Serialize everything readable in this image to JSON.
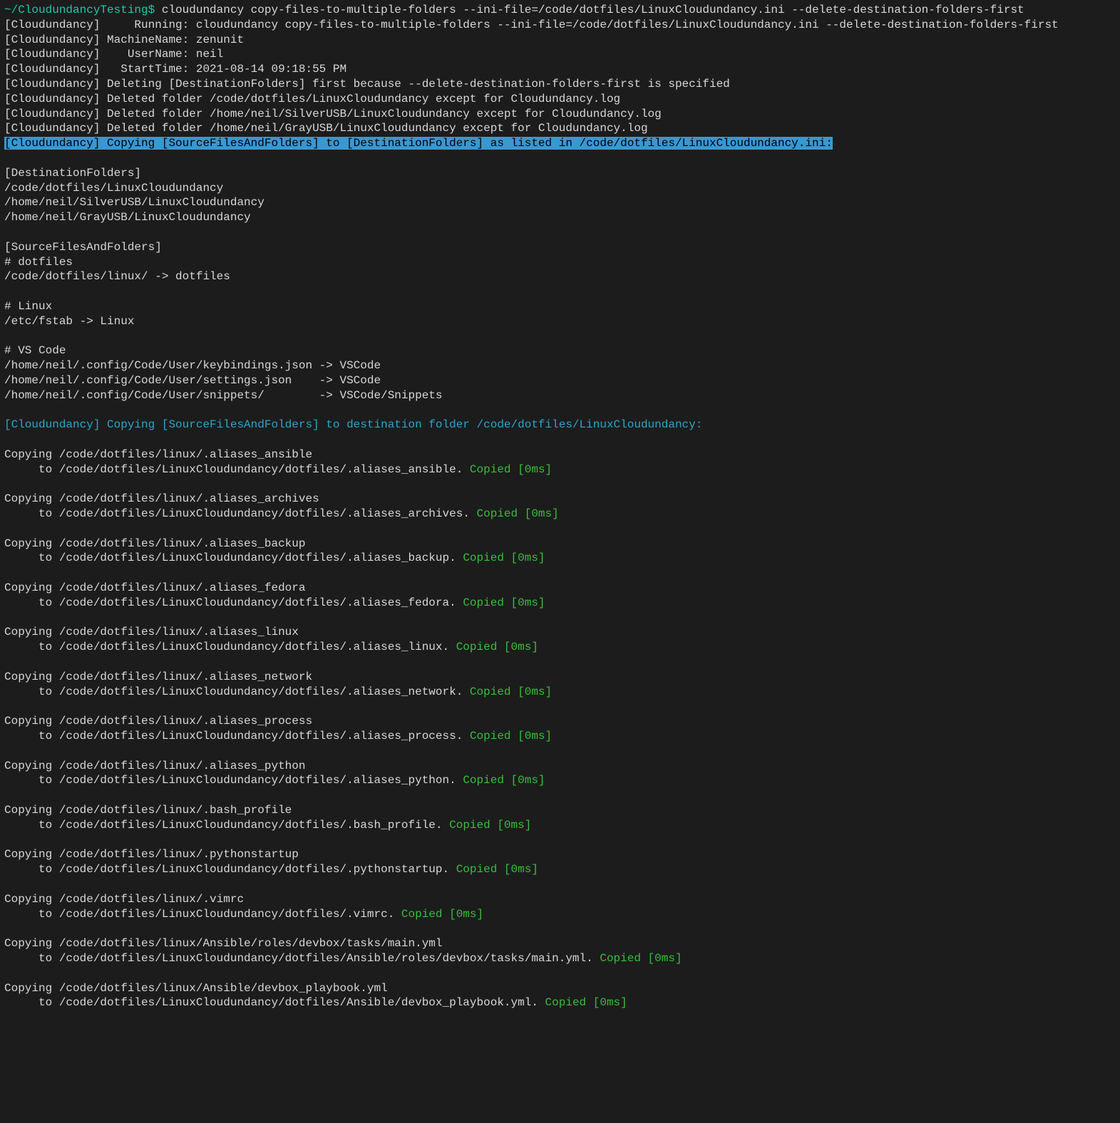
{
  "prompt": {
    "path": "~/CloudundancyTesting",
    "dollar": "$ "
  },
  "cmd": "cloudundancy copy-files-to-multiple-folders --ini-file=/code/dotfiles/LinuxCloudundancy.ini --delete-destination-folders-first",
  "hdr": [
    "[Cloudundancy]     Running: cloudundancy copy-files-to-multiple-folders --ini-file=/code/dotfiles/LinuxCloudundancy.ini --delete-destination-folders-first",
    "[Cloudundancy] MachineName: zenunit",
    "[Cloudundancy]    UserName: neil",
    "[Cloudundancy]   StartTime: 2021-08-14 09:18:55 PM",
    "[Cloudundancy] Deleting [DestinationFolders] first because --delete-destination-folders-first is specified",
    "[Cloudundancy] Deleted folder /code/dotfiles/LinuxCloudundancy except for Cloudundancy.log",
    "[Cloudundancy] Deleted folder /home/neil/SilverUSB/LinuxCloudundancy except for Cloudundancy.log",
    "[Cloudundancy] Deleted folder /home/neil/GrayUSB/LinuxCloudundancy except for Cloudundancy.log"
  ],
  "highlight": "[Cloudundancy] Copying [SourceFilesAndFolders] to [DestinationFolders] as listed in /code/dotfiles/LinuxCloudundancy.ini:",
  "body": [
    "",
    "[DestinationFolders]",
    "/code/dotfiles/LinuxCloudundancy",
    "/home/neil/SilverUSB/LinuxCloudundancy",
    "/home/neil/GrayUSB/LinuxCloudundancy",
    "",
    "[SourceFilesAndFolders]",
    "# dotfiles",
    "/code/dotfiles/linux/ -> dotfiles",
    "",
    "# Linux",
    "/etc/fstab -> Linux",
    "",
    "# VS Code",
    "/home/neil/.config/Code/User/keybindings.json -> VSCode",
    "/home/neil/.config/Code/User/settings.json    -> VSCode",
    "/home/neil/.config/Code/User/snippets/        -> VSCode/Snippets",
    ""
  ],
  "copyingHeader": "[Cloudundancy] Copying [SourceFilesAndFolders] to destination folder /code/dotfiles/LinuxCloudundancy:",
  "copies": [
    {
      "src": "Copying /code/dotfiles/linux/.aliases_ansible",
      "dst": "     to /code/dotfiles/LinuxCloudundancy/dotfiles/.aliases_ansible. ",
      "res": "Copied [0ms]"
    },
    {
      "src": "Copying /code/dotfiles/linux/.aliases_archives",
      "dst": "     to /code/dotfiles/LinuxCloudundancy/dotfiles/.aliases_archives. ",
      "res": "Copied [0ms]"
    },
    {
      "src": "Copying /code/dotfiles/linux/.aliases_backup",
      "dst": "     to /code/dotfiles/LinuxCloudundancy/dotfiles/.aliases_backup. ",
      "res": "Copied [0ms]"
    },
    {
      "src": "Copying /code/dotfiles/linux/.aliases_fedora",
      "dst": "     to /code/dotfiles/LinuxCloudundancy/dotfiles/.aliases_fedora. ",
      "res": "Copied [0ms]"
    },
    {
      "src": "Copying /code/dotfiles/linux/.aliases_linux",
      "dst": "     to /code/dotfiles/LinuxCloudundancy/dotfiles/.aliases_linux. ",
      "res": "Copied [0ms]"
    },
    {
      "src": "Copying /code/dotfiles/linux/.aliases_network",
      "dst": "     to /code/dotfiles/LinuxCloudundancy/dotfiles/.aliases_network. ",
      "res": "Copied [0ms]"
    },
    {
      "src": "Copying /code/dotfiles/linux/.aliases_process",
      "dst": "     to /code/dotfiles/LinuxCloudundancy/dotfiles/.aliases_process. ",
      "res": "Copied [0ms]"
    },
    {
      "src": "Copying /code/dotfiles/linux/.aliases_python",
      "dst": "     to /code/dotfiles/LinuxCloudundancy/dotfiles/.aliases_python. ",
      "res": "Copied [0ms]"
    },
    {
      "src": "Copying /code/dotfiles/linux/.bash_profile",
      "dst": "     to /code/dotfiles/LinuxCloudundancy/dotfiles/.bash_profile. ",
      "res": "Copied [0ms]"
    },
    {
      "src": "Copying /code/dotfiles/linux/.pythonstartup",
      "dst": "     to /code/dotfiles/LinuxCloudundancy/dotfiles/.pythonstartup. ",
      "res": "Copied [0ms]"
    },
    {
      "src": "Copying /code/dotfiles/linux/.vimrc",
      "dst": "     to /code/dotfiles/LinuxCloudundancy/dotfiles/.vimrc. ",
      "res": "Copied [0ms]"
    },
    {
      "src": "Copying /code/dotfiles/linux/Ansible/roles/devbox/tasks/main.yml",
      "dst": "     to /code/dotfiles/LinuxCloudundancy/dotfiles/Ansible/roles/devbox/tasks/main.yml. ",
      "res": "Copied [0ms]"
    },
    {
      "src": "Copying /code/dotfiles/linux/Ansible/devbox_playbook.yml",
      "dst": "     to /code/dotfiles/LinuxCloudundancy/dotfiles/Ansible/devbox_playbook.yml. ",
      "res": "Copied [0ms]"
    }
  ]
}
